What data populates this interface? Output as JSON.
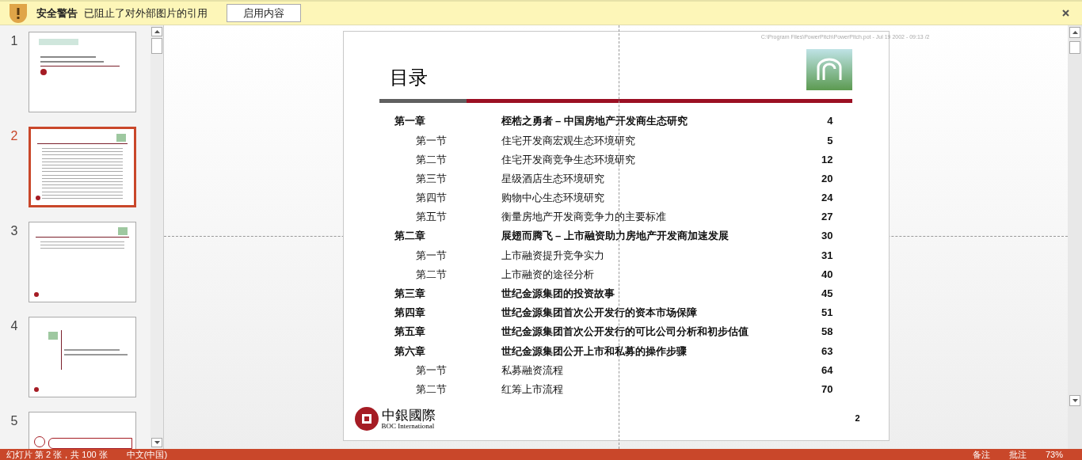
{
  "security_bar": {
    "title": "安全警告",
    "message": "已阻止了对外部图片的引用",
    "button": "启用内容"
  },
  "thumbnails": [
    {
      "number": "1",
      "selected": false,
      "kind": "cover"
    },
    {
      "number": "2",
      "selected": true,
      "kind": "toc"
    },
    {
      "number": "3",
      "selected": false,
      "kind": "toc_short"
    },
    {
      "number": "4",
      "selected": false,
      "kind": "chapter"
    },
    {
      "number": "5",
      "selected": false,
      "kind": "section"
    }
  ],
  "slide": {
    "file_path": "C:\\Program Files\\PowerPitch\\PowerPitch.pot - Jul 19 2002 - 09:13 /2",
    "title": "目录",
    "toc": [
      {
        "kind": "chapter",
        "label": "第一章",
        "title": "桎梏之勇者 – 中国房地产开发商生态研究",
        "page": "4"
      },
      {
        "kind": "section",
        "label": "第一节",
        "title": "住宅开发商宏观生态环境研究",
        "page": "5"
      },
      {
        "kind": "section",
        "label": "第二节",
        "title": "住宅开发商竞争生态环境研究",
        "page": "12"
      },
      {
        "kind": "section",
        "label": "第三节",
        "title": "星级酒店生态环境研究",
        "page": "20"
      },
      {
        "kind": "section",
        "label": "第四节",
        "title": "购物中心生态环境研究",
        "page": "24"
      },
      {
        "kind": "section",
        "label": "第五节",
        "title": "衡量房地产开发商竞争力的主要标准",
        "page": "27"
      },
      {
        "kind": "chapter",
        "label": "第二章",
        "title": "展翅而腾飞 – 上市融资助力房地产开发商加速发展",
        "page": "30"
      },
      {
        "kind": "section",
        "label": "第一节",
        "title": "上市融资提升竞争实力",
        "page": "31"
      },
      {
        "kind": "section",
        "label": "第二节",
        "title": "上市融资的途径分析",
        "page": "40"
      },
      {
        "kind": "chapter",
        "label": "第三章",
        "title": "世纪金源集团的投资故事",
        "page": "45"
      },
      {
        "kind": "chapter",
        "label": "第四章",
        "title": "世纪金源集团首次公开发行的资本市场保障",
        "page": "51"
      },
      {
        "kind": "chapter",
        "label": "第五章",
        "title": "世纪金源集团首次公开发行的可比公司分析和初步估值",
        "page": "58"
      },
      {
        "kind": "chapter",
        "label": "第六章",
        "title": "世纪金源集团公开上市和私募的操作步骤",
        "page": "63"
      },
      {
        "kind": "section",
        "label": "第一节",
        "title": "私募融资流程",
        "page": "64"
      },
      {
        "kind": "section",
        "label": "第二节",
        "title": "红筹上市流程",
        "page": "70"
      }
    ],
    "logo_chinese": "中銀國際",
    "logo_english": "BOC International",
    "page_number": "2"
  },
  "status_bar": {
    "slide_info": "幻灯片 第 2 张，共 100 张",
    "language": "中文(中国)",
    "notes": "备注",
    "comments": "批注",
    "zoom": "73%"
  }
}
